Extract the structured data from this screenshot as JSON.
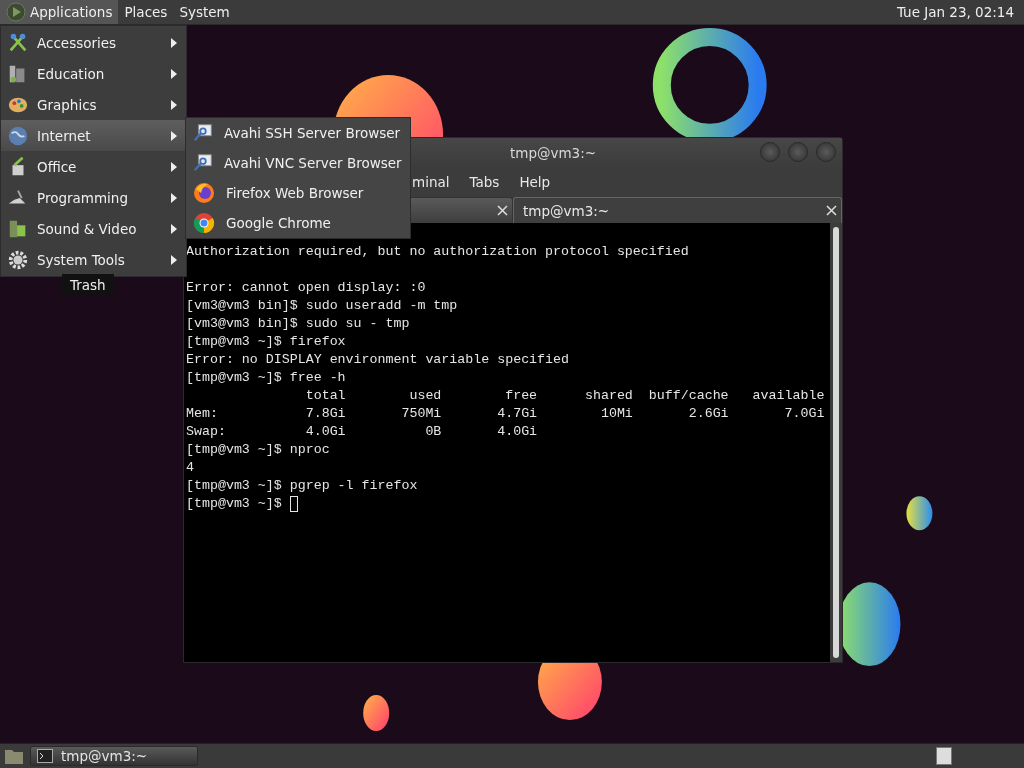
{
  "top_panel": {
    "menus": [
      {
        "label": "Applications",
        "selected": true
      },
      {
        "label": "Places",
        "selected": false
      },
      {
        "label": "System",
        "selected": false
      }
    ],
    "clock": "Tue Jan 23, 02:14"
  },
  "applications_menu": {
    "items": [
      {
        "label": "Accessories",
        "selected": false
      },
      {
        "label": "Education",
        "selected": false
      },
      {
        "label": "Graphics",
        "selected": false
      },
      {
        "label": "Internet",
        "selected": true
      },
      {
        "label": "Office",
        "selected": false
      },
      {
        "label": "Programming",
        "selected": false
      },
      {
        "label": "Sound & Video",
        "selected": false
      },
      {
        "label": "System Tools",
        "selected": false
      }
    ],
    "submenu": [
      {
        "label": "Avahi SSH Server Browser"
      },
      {
        "label": "Avahi VNC Server Browser"
      },
      {
        "label": "Firefox Web Browser"
      },
      {
        "label": "Google Chrome"
      }
    ]
  },
  "tooltip": "Trash",
  "terminal": {
    "title": "tmp@vm3:~",
    "menus": [
      "minal",
      "Tabs",
      "Help"
    ],
    "tabs": [
      {
        "selected": false
      },
      {
        "label": "tmp@vm3:~",
        "selected": true
      }
    ],
    "lines": [
      {
        "text": "Authorization required, but no authorization protocol specified",
        "blank_after": true
      },
      {
        "text": "Error: cannot open display: :0",
        "blank_after": false
      },
      {
        "text": "[vm3@vm3 bin]$ sudo useradd -m tmp",
        "blank_after": false
      },
      {
        "text": "[vm3@vm3 bin]$ sudo su - tmp",
        "blank_after": false
      },
      {
        "text": "[tmp@vm3 ~]$ firefox",
        "blank_after": false
      },
      {
        "text": "Error: no DISPLAY environment variable specified",
        "blank_after": false
      },
      {
        "text": "[tmp@vm3 ~]$ free -h",
        "blank_after": false
      },
      {
        "text": "               total        used        free      shared  buff/cache   available",
        "blank_after": false
      },
      {
        "text": "Mem:           7.8Gi       750Mi       4.7Gi        10Mi       2.6Gi       7.0Gi",
        "blank_after": false
      },
      {
        "text": "Swap:          4.0Gi          0B       4.0Gi",
        "blank_after": false
      },
      {
        "text": "[tmp@vm3 ~]$ nproc",
        "blank_after": false
      },
      {
        "text": "4",
        "blank_after": false
      },
      {
        "text": "[tmp@vm3 ~]$ pgrep -l firefox",
        "blank_after": false
      },
      {
        "text": "[tmp@vm3 ~]$ ",
        "blank_after": false
      }
    ],
    "cursor": true
  },
  "taskbar": {
    "tasks": [
      {
        "label": "tmp@vm3:~",
        "selected": false
      }
    ]
  }
}
